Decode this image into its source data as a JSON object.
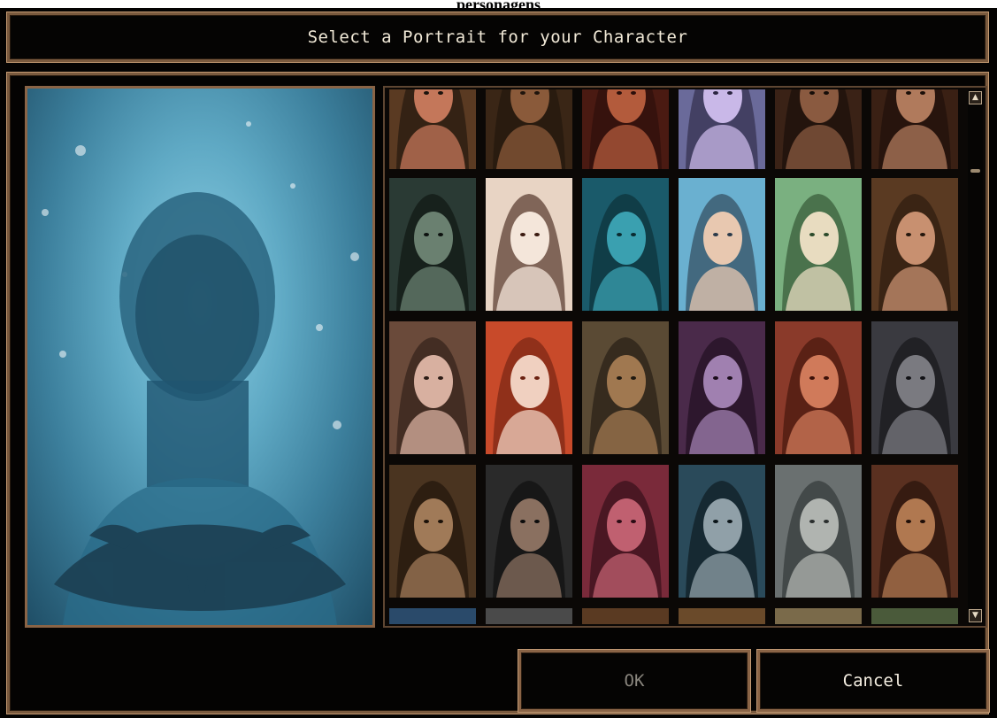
{
  "page": {
    "caption": "personagens"
  },
  "dialog": {
    "title": "Select a Portrait for your Character",
    "preview_icon": "eye-sigil-icon",
    "buttons": {
      "ok_label": "OK",
      "cancel_label": "Cancel"
    }
  },
  "colors": {
    "frame_bronze": "#7a5a3e",
    "ok_text_disabled": "#8a867e",
    "cancel_text": "#f5efe2"
  },
  "scrollbar": {
    "up_icon": "scroll-up-arrow-icon",
    "down_icon": "scroll-down-arrow-icon"
  },
  "portraits": [
    {
      "row": 0,
      "name": "portrait-red-haired-woman",
      "c": [
        "#5a3a22",
        "#c4775a",
        "#1a120c"
      ]
    },
    {
      "row": 0,
      "name": "portrait-candle-woman",
      "c": [
        "#3a2616",
        "#8a5a3a",
        "#1e140c"
      ]
    },
    {
      "row": 0,
      "name": "portrait-red-dress-woman",
      "c": [
        "#4a1a12",
        "#b35b3c",
        "#2a0e0a"
      ]
    },
    {
      "row": 0,
      "name": "portrait-purple-elf-woman",
      "c": [
        "#6a6a9a",
        "#c9b8e8",
        "#2a2440"
      ]
    },
    {
      "row": 0,
      "name": "portrait-dark-skin-woman",
      "c": [
        "#3a2216",
        "#8a5a40",
        "#140c08"
      ]
    },
    {
      "row": 0,
      "name": "portrait-auburn-woman",
      "c": [
        "#3a2014",
        "#b07a5c",
        "#1a0e08"
      ]
    },
    {
      "row": 1,
      "name": "portrait-hooded-rogue",
      "c": [
        "#2a3a34",
        "#6a8070",
        "#0c100e"
      ]
    },
    {
      "row": 1,
      "name": "portrait-pale-woman",
      "c": [
        "#e8d4c4",
        "#f4e6da",
        "#3a1a10"
      ]
    },
    {
      "row": 1,
      "name": "portrait-teal-woman",
      "c": [
        "#1a5a6a",
        "#3aa0b0",
        "#0a2a30"
      ]
    },
    {
      "row": 1,
      "name": "portrait-blue-bg-woman",
      "c": [
        "#6ab0d0",
        "#e8c8b0",
        "#2a3a4a"
      ]
    },
    {
      "row": 1,
      "name": "portrait-bamboo-woman",
      "c": [
        "#7ab080",
        "#e8dcc0",
        "#2a4a2a"
      ]
    },
    {
      "row": 1,
      "name": "portrait-brown-hair-woman",
      "c": [
        "#5a3a22",
        "#c89070",
        "#24160c"
      ]
    },
    {
      "row": 2,
      "name": "portrait-brunette-woman",
      "c": [
        "#6a4a3a",
        "#d8b0a0",
        "#2a1a14"
      ]
    },
    {
      "row": 2,
      "name": "portrait-red-hair-elf",
      "c": [
        "#c84a2a",
        "#f0d0c0",
        "#6a2010"
      ]
    },
    {
      "row": 2,
      "name": "portrait-bald-warrior",
      "c": [
        "#5a4a34",
        "#a07850",
        "#1e1810"
      ]
    },
    {
      "row": 2,
      "name": "portrait-masked-purple",
      "c": [
        "#4a2a4a",
        "#a080b0",
        "#1a0c1a"
      ]
    },
    {
      "row": 2,
      "name": "portrait-tattooed-monk",
      "c": [
        "#8a3a2a",
        "#d07a5a",
        "#3a1008"
      ]
    },
    {
      "row": 2,
      "name": "portrait-hooded-assassin",
      "c": [
        "#3a3a40",
        "#7a7a80",
        "#101014"
      ]
    },
    {
      "row": 3,
      "name": "portrait-dark-hair-man",
      "c": [
        "#4a3420",
        "#a07a58",
        "#1a1008"
      ]
    },
    {
      "row": 3,
      "name": "portrait-long-hair-man",
      "c": [
        "#2a2a2a",
        "#8a7060",
        "#0c0c0c"
      ]
    },
    {
      "row": 3,
      "name": "portrait-red-hair-man",
      "c": [
        "#7a2a3a",
        "#c06070",
        "#2a0c14"
      ]
    },
    {
      "row": 3,
      "name": "portrait-scarred-elf",
      "c": [
        "#2a4a5a",
        "#90a0a8",
        "#0a1418"
      ]
    },
    {
      "row": 3,
      "name": "portrait-armored-knight",
      "c": [
        "#6a7070",
        "#b0b4b0",
        "#2a2e2e"
      ]
    },
    {
      "row": 3,
      "name": "portrait-barbarian",
      "c": [
        "#5a3020",
        "#b07850",
        "#1e0e08"
      ]
    },
    {
      "row": 4,
      "name": "portrait-blue-figure",
      "c": [
        "#2a4a6a",
        "#5a7a9a",
        "#0c1420"
      ]
    },
    {
      "row": 4,
      "name": "portrait-grey-figure",
      "c": [
        "#4a4a4a",
        "#8a8a8a",
        "#141414"
      ]
    },
    {
      "row": 4,
      "name": "portrait-brown-figure",
      "c": [
        "#5a3a22",
        "#a07a58",
        "#1a1008"
      ]
    },
    {
      "row": 4,
      "name": "portrait-bronze-figure",
      "c": [
        "#6a4a2a",
        "#b08a60",
        "#221608"
      ]
    },
    {
      "row": 4,
      "name": "portrait-tan-figure",
      "c": [
        "#7a6a4a",
        "#c0a880",
        "#2a2214"
      ]
    },
    {
      "row": 4,
      "name": "portrait-olive-figure",
      "c": [
        "#4a5a3a",
        "#8a9a70",
        "#141a0e"
      ]
    }
  ]
}
